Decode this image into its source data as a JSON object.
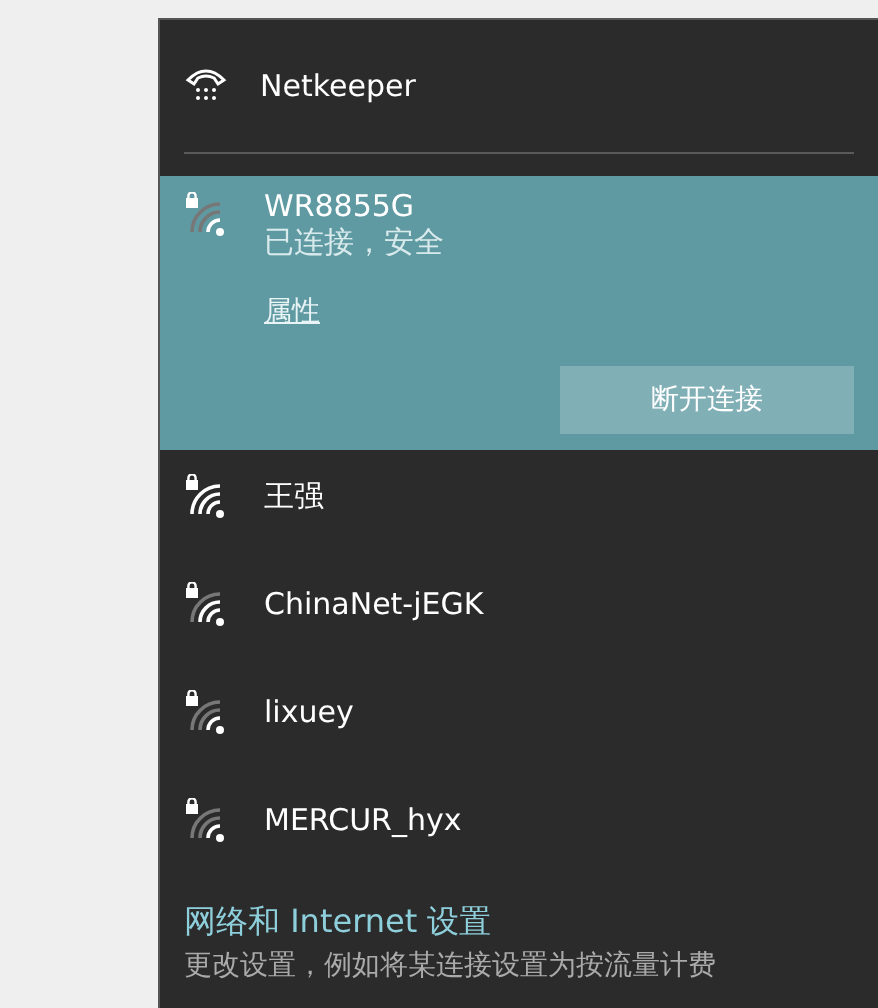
{
  "dialup": {
    "name": "Netkeeper"
  },
  "networks": [
    {
      "name": "WR8855G",
      "secured": true,
      "kind": "fair",
      "selected": true,
      "status": "已连接，安全",
      "properties_link": "属性",
      "disconnect_button": "断开连接"
    },
    {
      "name": "王强",
      "secured": true,
      "kind": "strong",
      "selected": false
    },
    {
      "name": "ChinaNet-jEGK",
      "secured": true,
      "kind": "good",
      "selected": false
    },
    {
      "name": "lixuey",
      "secured": true,
      "kind": "fair",
      "selected": false
    },
    {
      "name": "MERCUR_hyx",
      "secured": true,
      "kind": "fair",
      "selected": false
    }
  ],
  "settings": {
    "link": "网络和 Internet 设置",
    "description": "更改设置，例如将某连接设置为按流量计费"
  }
}
